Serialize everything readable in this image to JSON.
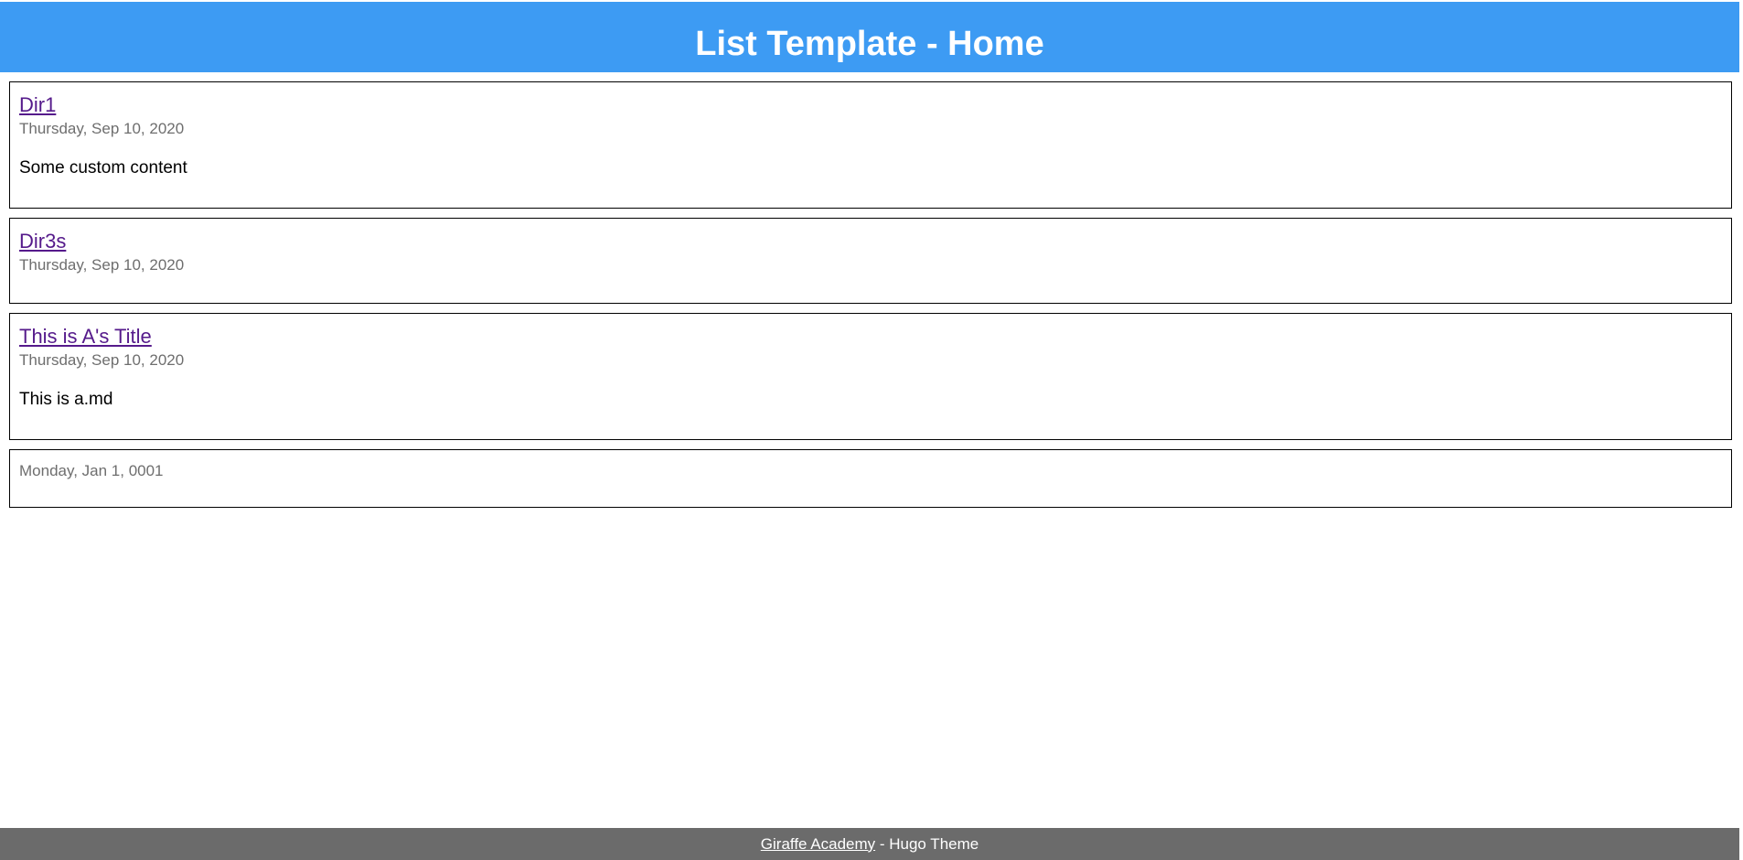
{
  "header": {
    "title": "List Template - Home",
    "background_color": "#3d9bf3"
  },
  "posts": [
    {
      "title": "Dir1",
      "date": "Thursday, Sep 10, 2020",
      "content": "Some custom content"
    },
    {
      "title": "Dir3s",
      "date": "Thursday, Sep 10, 2020",
      "content": ""
    },
    {
      "title": "This is A's Title",
      "date": "Thursday, Sep 10, 2020",
      "content": "This is a.md"
    },
    {
      "title": "",
      "date": "Monday, Jan 1, 0001",
      "content": ""
    }
  ],
  "footer": {
    "link_text": "Giraffe Academy",
    "suffix": " - Hugo Theme",
    "background_color": "#6b6b6b"
  },
  "colors": {
    "link": "#551a8b",
    "date": "#6e6e6e",
    "border": "#000000"
  }
}
